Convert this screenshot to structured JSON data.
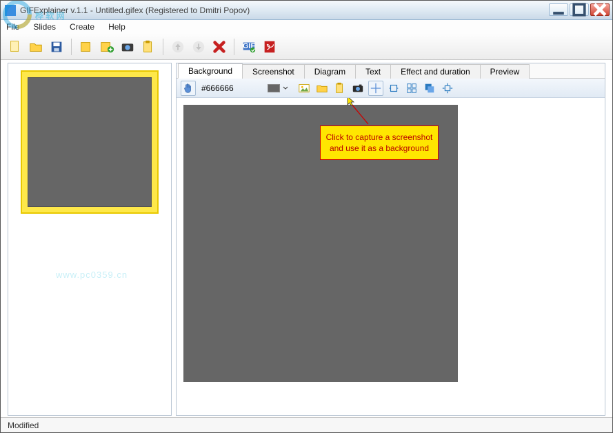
{
  "window": {
    "title": "GIFExplainer v.1.1 - Untitled.gifex (Registered to Dmitri Popov)"
  },
  "menu": {
    "file": "File",
    "slides": "Slides",
    "create": "Create",
    "help": "Help"
  },
  "toolbar": {
    "new": "new-document-icon",
    "open": "open-folder-icon",
    "save": "save-icon",
    "new_slide": "new-slide-icon",
    "add_screenshot": "add-screenshot-icon",
    "camera": "camera-icon",
    "paste_slide": "paste-slide-icon",
    "arrow_up": "arrow-up-icon",
    "arrow_down": "arrow-down-icon",
    "delete": "delete-icon",
    "export_gif": "export-gif-icon",
    "export_pdf": "export-pdf-icon"
  },
  "tabs": {
    "background": "Background",
    "screenshot": "Screenshot",
    "diagram": "Diagram",
    "text": "Text",
    "effect": "Effect and duration",
    "preview": "Preview"
  },
  "background_toolbar": {
    "hand_icon": "hand-icon",
    "color_code": "#666666",
    "swatch_color": "#666666",
    "image_icon": "image-icon",
    "open_icon": "open-icon",
    "paste_icon": "paste-icon",
    "camera_icon": "camera-icon",
    "crosshair_icon": "crosshair-icon",
    "fit_icon": "fit-width-icon",
    "grid_icon": "grid-icon",
    "layers_icon": "layers-icon",
    "outward_icon": "outward-icon"
  },
  "tooltip": {
    "line1": "Click to capture a screenshot",
    "line2": "and use it as a background"
  },
  "status": {
    "text": "Modified"
  },
  "watermarks": {
    "logo_top_chars": "桦 软 网",
    "url": "www.pc0359.cn"
  }
}
